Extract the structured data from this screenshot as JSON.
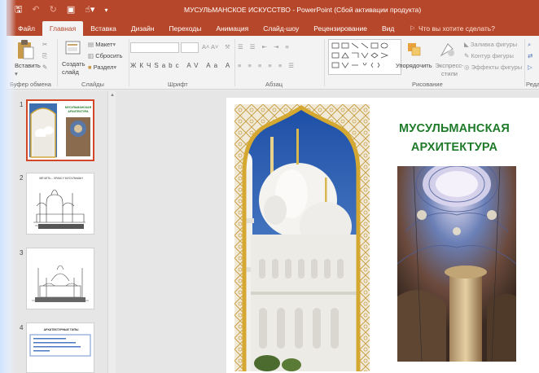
{
  "titlebar": {
    "title": "МУСУЛЬМАНСКОЕ ИСКУССТВО - PowerPoint (Сбой активации продукта)"
  },
  "tabs": [
    {
      "label": "Файл"
    },
    {
      "label": "Главная",
      "active": true
    },
    {
      "label": "Вставка"
    },
    {
      "label": "Дизайн"
    },
    {
      "label": "Переходы"
    },
    {
      "label": "Анимация"
    },
    {
      "label": "Слайд-шоу"
    },
    {
      "label": "Рецензирование"
    },
    {
      "label": "Вид"
    }
  ],
  "tell_me": "Что вы хотите сделать?",
  "ribbon": {
    "paste": "Вставить",
    "new_slide": "Создать слайд",
    "layout": "Макет",
    "reset": "Сбросить",
    "section": "Раздел",
    "arrange": "Упорядочить",
    "quick_styles": "Экспресс-стили",
    "shape_fill": "Заливка фигуры",
    "shape_outline": "Контур фигуры",
    "shape_effects": "Эффекты фигуры",
    "groups": {
      "clipboard": "Буфер обмена",
      "slides": "Слайды",
      "font": "Шрифт",
      "paragraph": "Абзац",
      "drawing": "Рисование",
      "editing": "Реда"
    }
  },
  "thumbnails": [
    {
      "number": "1",
      "caption": "МУСУЛЬМАНСКАЯ АРХИТЕКТУРА",
      "active": true
    },
    {
      "number": "2",
      "caption": "МЕЧЕТЬ - ХРАМ У МУСУЛЬМАН"
    },
    {
      "number": "3",
      "caption": ""
    },
    {
      "number": "4",
      "caption": "АРХИТЕКТУРНЫЕ ТИПЫ"
    }
  ],
  "slide": {
    "title_line1": "МУСУЛЬМАНСКАЯ",
    "title_line2": "АРХИТЕКТУРА",
    "title_color": "#1f7a2a"
  },
  "colors": {
    "accent": "#b7472a",
    "active_thumb_border": "#d24726"
  }
}
